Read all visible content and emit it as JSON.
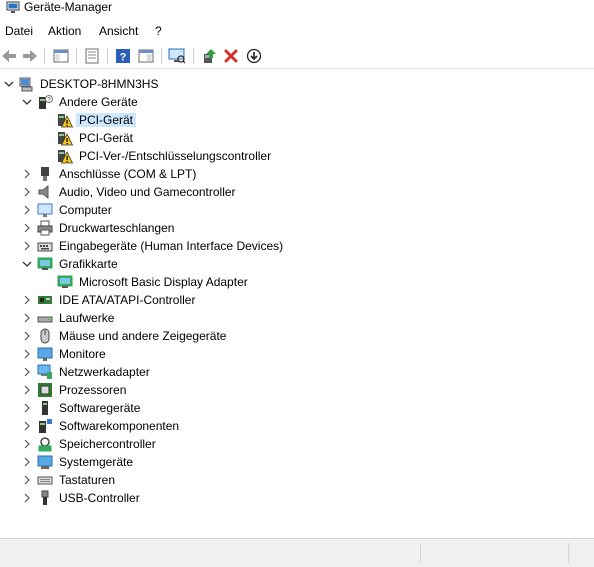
{
  "window": {
    "title": "Geräte-Manager"
  },
  "menu": {
    "items": [
      "Datei",
      "Aktion",
      "Ansicht",
      "?"
    ]
  },
  "tree": {
    "root": "DESKTOP-8HMN3HS",
    "groups": [
      {
        "label": "Andere Geräte",
        "expanded": true,
        "icon": "unknown-device-icon",
        "children": [
          {
            "label": "PCI-Gerät",
            "icon": "warning-device-icon",
            "selected": true
          },
          {
            "label": "PCI-Gerät",
            "icon": "warning-device-icon",
            "selected": false
          },
          {
            "label": "PCI-Ver-/Entschlüsselungscontroller",
            "icon": "warning-device-icon",
            "selected": false
          }
        ]
      },
      {
        "label": "Anschlüsse (COM & LPT)",
        "expanded": false,
        "icon": "port-icon"
      },
      {
        "label": "Audio, Video und Gamecontroller",
        "expanded": false,
        "icon": "speaker-icon"
      },
      {
        "label": "Computer",
        "expanded": false,
        "icon": "computer-icon"
      },
      {
        "label": "Druckwarteschlangen",
        "expanded": false,
        "icon": "printer-icon"
      },
      {
        "label": "Eingabegeräte (Human Interface Devices)",
        "expanded": false,
        "icon": "keyboard-hid-icon"
      },
      {
        "label": "Grafikkarte",
        "expanded": true,
        "icon": "display-adapter-icon",
        "children": [
          {
            "label": "Microsoft Basic Display Adapter",
            "icon": "display-adapter-icon",
            "selected": false
          }
        ]
      },
      {
        "label": "IDE ATA/ATAPI-Controller",
        "expanded": false,
        "icon": "ide-controller-icon"
      },
      {
        "label": "Laufwerke",
        "expanded": false,
        "icon": "disk-drive-icon"
      },
      {
        "label": "Mäuse und andere Zeigegeräte",
        "expanded": false,
        "icon": "mouse-icon"
      },
      {
        "label": "Monitore",
        "expanded": false,
        "icon": "monitor-icon"
      },
      {
        "label": "Netzwerkadapter",
        "expanded": false,
        "icon": "network-adapter-icon"
      },
      {
        "label": "Prozessoren",
        "expanded": false,
        "icon": "processor-icon"
      },
      {
        "label": "Softwaregeräte",
        "expanded": false,
        "icon": "software-device-icon"
      },
      {
        "label": "Softwarekomponenten",
        "expanded": false,
        "icon": "software-component-icon"
      },
      {
        "label": "Speichercontroller",
        "expanded": false,
        "icon": "storage-controller-icon"
      },
      {
        "label": "Systemgeräte",
        "expanded": false,
        "icon": "system-device-icon"
      },
      {
        "label": "Tastaturen",
        "expanded": false,
        "icon": "keyboard-icon"
      },
      {
        "label": "USB-Controller",
        "expanded": false,
        "icon": "usb-icon"
      }
    ]
  },
  "colors": {
    "selection": "#cce8ff",
    "warning": "#f5c518",
    "remove": "#d32f2f",
    "enable": "#2e9e3e"
  }
}
